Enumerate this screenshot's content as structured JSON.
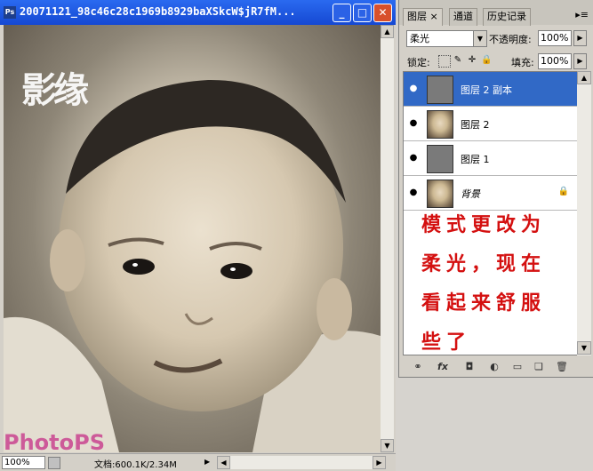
{
  "document": {
    "title": "20071121_98c46c28c1969b8929baXSkcW$jR7fM...",
    "app_icon": "Ps",
    "zoom": "100%",
    "info": "文档:600.1K/2.34M",
    "window_buttons": [
      "_",
      "□",
      "✕"
    ]
  },
  "canvas": {
    "logo_text": "影缘",
    "watermark": "PhotoPS"
  },
  "panel": {
    "tabs": [
      {
        "label": "图层",
        "close": "×"
      },
      {
        "label": "通道"
      },
      {
        "label": "历史记录"
      }
    ],
    "menu_icon": "▸≡",
    "blend_mode": "柔光",
    "opacity_label": "不透明度:",
    "opacity_value": "100%",
    "lock_label": "锁定:",
    "fill_label": "填充:",
    "fill_value": "100%",
    "layers": [
      {
        "name": "图层 2 副本",
        "selected": true,
        "thumb": "gray"
      },
      {
        "name": "图层 2",
        "selected": false,
        "thumb": "face"
      },
      {
        "name": "图层 1",
        "selected": false,
        "thumb": "gray"
      },
      {
        "name": "背景",
        "selected": false,
        "thumb": "face",
        "locked": true
      }
    ],
    "annotation": [
      "模式更改为",
      "柔光，现在",
      "看起来舒服",
      "些了"
    ],
    "footer_icons": [
      "link-icon",
      "fx-icon",
      "mask-icon",
      "adjustment-icon",
      "folder-icon",
      "new-layer-icon",
      "trash-icon"
    ]
  }
}
